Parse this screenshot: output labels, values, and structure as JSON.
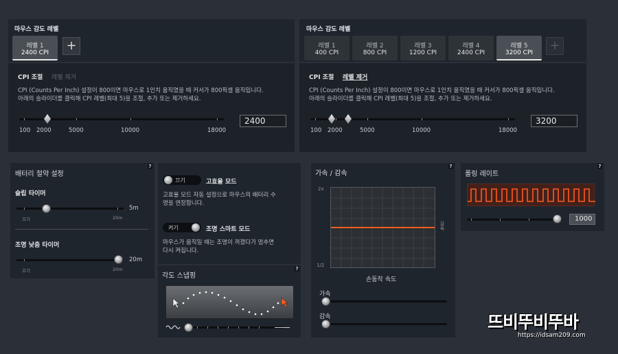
{
  "sensitivity_left": {
    "title": "마우스 감도 레벨",
    "tabs": [
      {
        "label": "레벨 1",
        "cpi": "2400 CPI"
      }
    ],
    "add": "+",
    "cpi_tab": "CPI 조절",
    "remove_tab": "레벨 제거",
    "desc1": "CPI (Counts Per Inch) 설정이 800이면 마우스로 1인치 움직였을 때 커서가 800픽셀 움직입니다.",
    "desc2": "아래의 슬라이더를 클릭해 CPI 레벨(최대 5)을 조절, 추가 또는 제거하세요.",
    "ticks": [
      "100",
      "2000",
      "5000",
      "10000",
      "18000"
    ],
    "value": "2400"
  },
  "sensitivity_right": {
    "title": "마우스 감도 레벨",
    "tabs": [
      {
        "label": "레벨 1",
        "cpi": "400 CPI"
      },
      {
        "label": "레벨 2",
        "cpi": "800 CPI"
      },
      {
        "label": "레벨 3",
        "cpi": "1200 CPI"
      },
      {
        "label": "레벨 4",
        "cpi": "2400 CPI"
      },
      {
        "label": "레벨 5",
        "cpi": "3200 CPI"
      }
    ],
    "add": "+",
    "cpi_tab": "CPI 조절",
    "remove_tab": "레벨 제거",
    "desc1": "CPI (Counts Per Inch) 설정이 800이면 마우스로 1인치 움직였을 때 커서가 800픽셀 움직입니다.",
    "desc2": "아래의 슬라이더를 클릭해 CPI 레벨(최대 5)을 조절, 추가 또는 제거하세요.",
    "ticks": [
      "100",
      "2000",
      "5000",
      "10000",
      "18000"
    ],
    "value": "3200"
  },
  "battery": {
    "title": "배터리 절약 설정",
    "help": "?",
    "sleep": {
      "label": "슬립 타이머",
      "value": "5m",
      "min": "끄기",
      "max": "20m"
    },
    "dim": {
      "label": "조명 낮춤 타이머",
      "value": "20m",
      "min": "끄기",
      "max": "20m"
    }
  },
  "modes": {
    "high_eff": {
      "toggle": "끄기",
      "label": "고효율 모드",
      "desc1": "고효율 모드 자동 설정으로 마우스의 배터리 수",
      "desc2": "명을 연장합니다."
    },
    "smart_light": {
      "toggle": "켜기",
      "label": "조명 스마트 모드",
      "desc1": "마우스가 움직일 때는 조명이 꺼졌다가 멈추면",
      "desc2": "다시 켜집니다."
    }
  },
  "angle": {
    "title": "각도 스냅핑",
    "help": "?"
  },
  "accel": {
    "title": "가속 / 감속",
    "help": "?",
    "y_top": "2x",
    "y_bottom": "1/2",
    "right_label": "감속",
    "x_label": "손동작 속도",
    "accel_label": "가속",
    "decel_label": "감속"
  },
  "polling": {
    "title": "폴링 레이트",
    "help": "?",
    "value": "1000"
  },
  "watermark": {
    "brand": "뜨비뚜비뚜바",
    "url": "https://idsam209.com"
  },
  "colors": {
    "accent": "#ff5a1f",
    "panel": "#1f252d",
    "bg": "#2b3038"
  }
}
